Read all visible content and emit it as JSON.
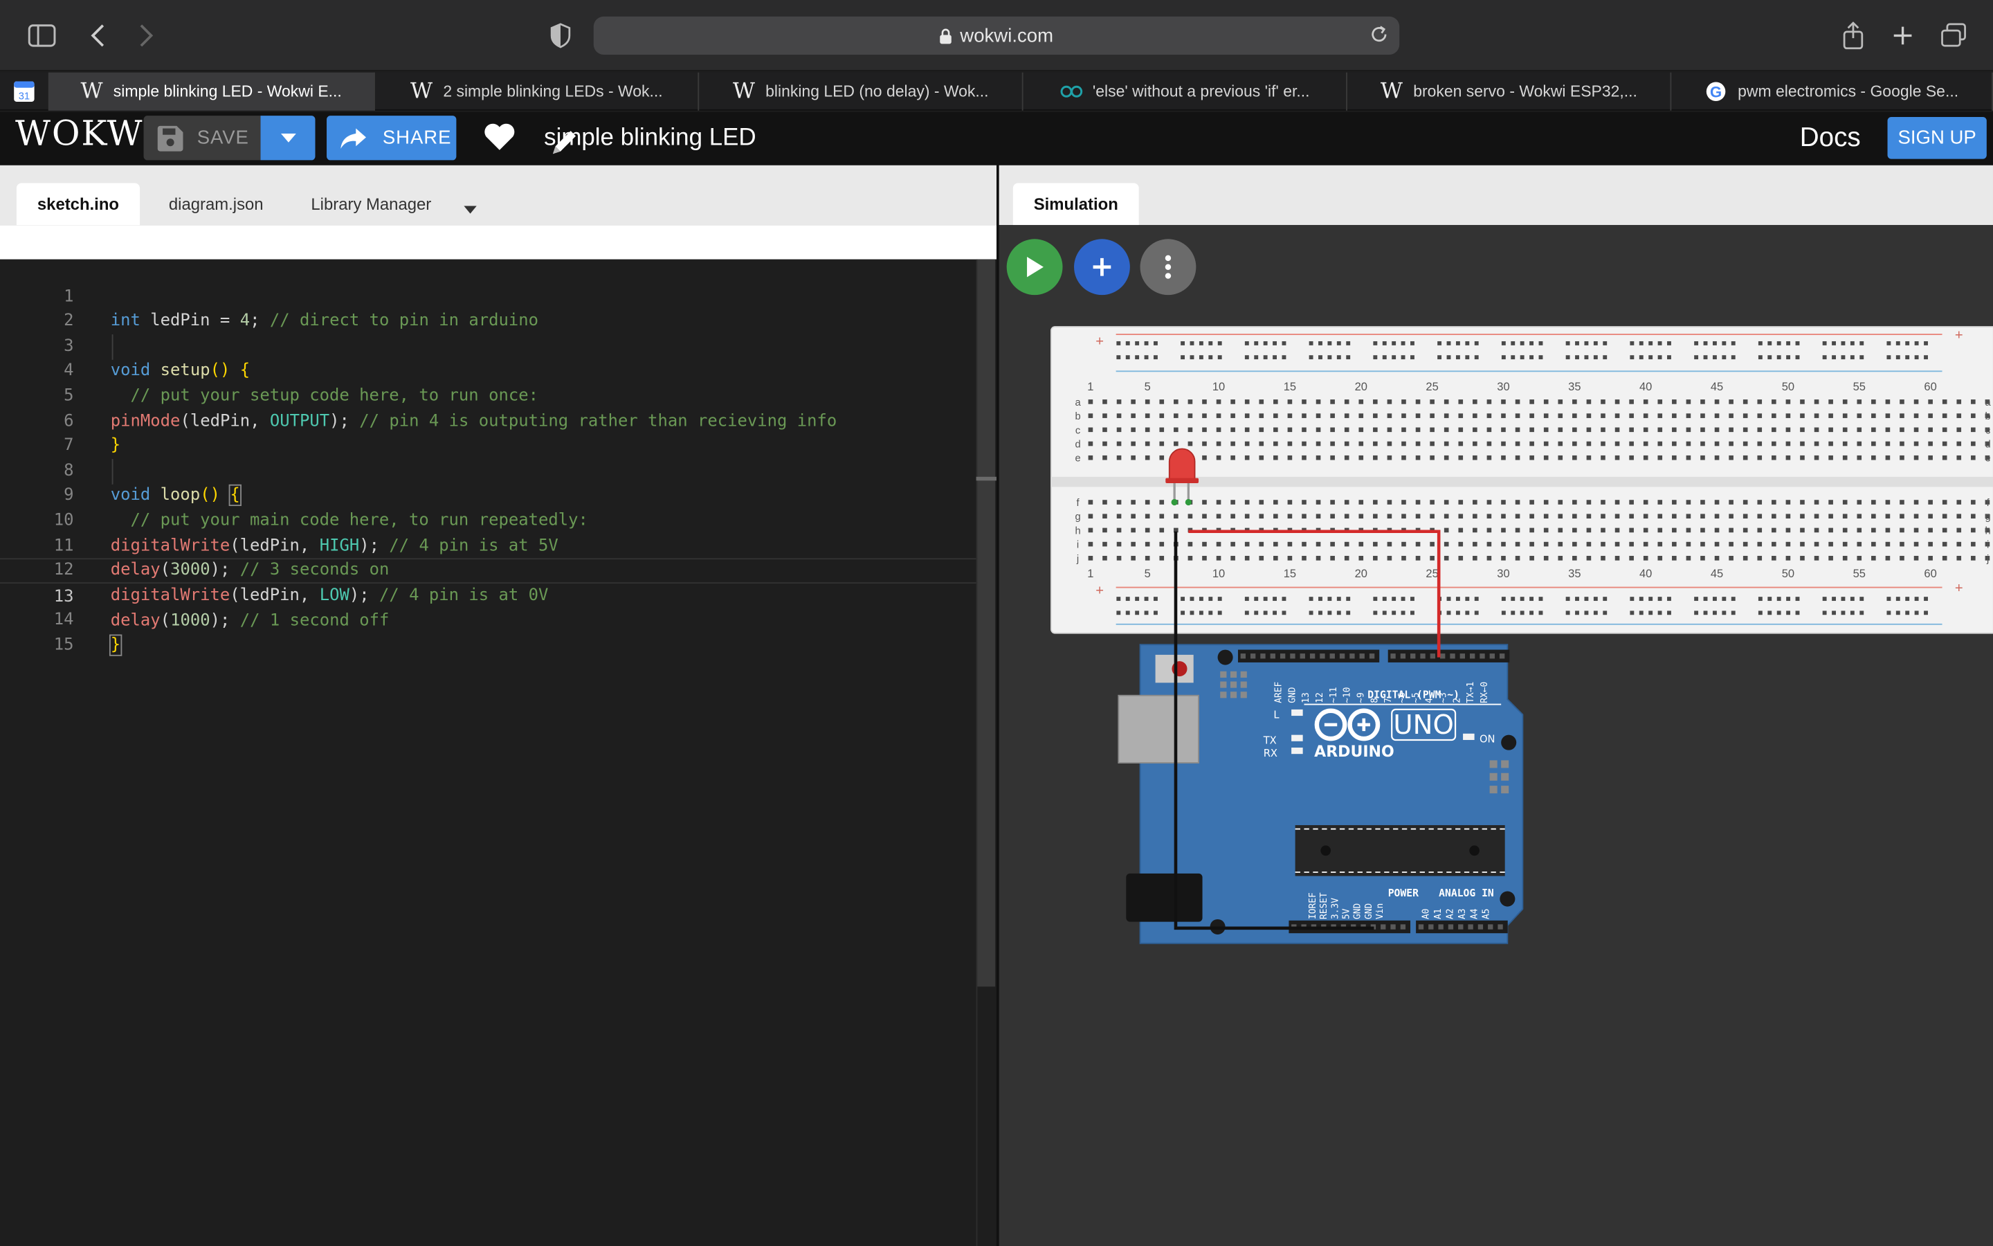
{
  "browser": {
    "url": "wokwi.com",
    "tabs": [
      "simple blinking LED - Wokwi E...",
      "2 simple blinking LEDs - Wok...",
      "blinking LED (no delay) - Wok...",
      "'else' without a previous 'if' er...",
      "broken servo - Wokwi ESP32,...",
      "pwm electromics - Google Se..."
    ],
    "calendar_day": "31"
  },
  "header": {
    "logo": "WOKWI",
    "save_label": "SAVE",
    "share_label": "SHARE",
    "project_title": "simple blinking LED",
    "docs_label": "Docs",
    "signup_label": "SIGN UP"
  },
  "editor": {
    "tabs": [
      "sketch.ino",
      "diagram.json",
      "Library Manager"
    ],
    "active_tab": "sketch.ino",
    "current_line": 13,
    "line_numbers": [
      "1",
      "2",
      "3",
      "4",
      "5",
      "6",
      "7",
      "8",
      "9",
      "10",
      "11",
      "12",
      "13",
      "14",
      "15"
    ],
    "lines": [
      "int ledPin = 4; // direct to pin in arduino",
      "",
      "void setup() {",
      "  // put your setup code here, to run once:",
      "pinMode(ledPin, OUTPUT); // pin 4 is outputing rather than recieving info",
      "}",
      "",
      "void loop() {",
      "  // put your main code here, to run repeatedly:",
      "digitalWrite(ledPin, HIGH); // 4 pin is at 5V",
      "delay(3000); // 3 seconds on",
      "digitalWrite(ledPin, LOW); // 4 pin is at 0V",
      "delay(1000); // 1 second off",
      "}",
      ""
    ]
  },
  "simulation": {
    "tab_label": "Simulation",
    "breadboard": {
      "column_labels": [
        "1",
        "5",
        "10",
        "15",
        "20",
        "25",
        "30",
        "35",
        "40",
        "45",
        "50",
        "55",
        "60"
      ],
      "row_labels_top": [
        "a",
        "b",
        "c",
        "d",
        "e"
      ],
      "row_labels_bottom": [
        "f",
        "g",
        "h",
        "i",
        "j"
      ],
      "plus": "+",
      "minus": "-"
    },
    "arduino": {
      "brand": "ARDUINO",
      "model": "UNO",
      "digital_label": "DIGITAL (PWM ~)",
      "power_label": "POWER",
      "analog_label": "ANALOG IN",
      "on_label": "ON",
      "tx_label": "TX",
      "rx_label": "RX",
      "l_label": "L",
      "top_pins": [
        "AREF",
        "GND",
        "13",
        "12",
        "~11",
        "~10",
        "~9",
        "8",
        "7",
        "~6",
        "~5",
        "4",
        "~3",
        "2",
        "TX→1",
        "RX←0"
      ],
      "power_pins": [
        "IOREF",
        "RESET",
        "3.3V",
        "5V",
        "GND",
        "GND",
        "Vin"
      ],
      "analog_pins": [
        "A0",
        "A1",
        "A2",
        "A3",
        "A4",
        "A5"
      ]
    },
    "colors": {
      "led": "#e0403c",
      "wire_signal": "#d42a2a",
      "wire_ground": "#111111",
      "board": "#3b73b0",
      "run_button": "#3fa04a",
      "add_button": "#2f65c9"
    }
  }
}
